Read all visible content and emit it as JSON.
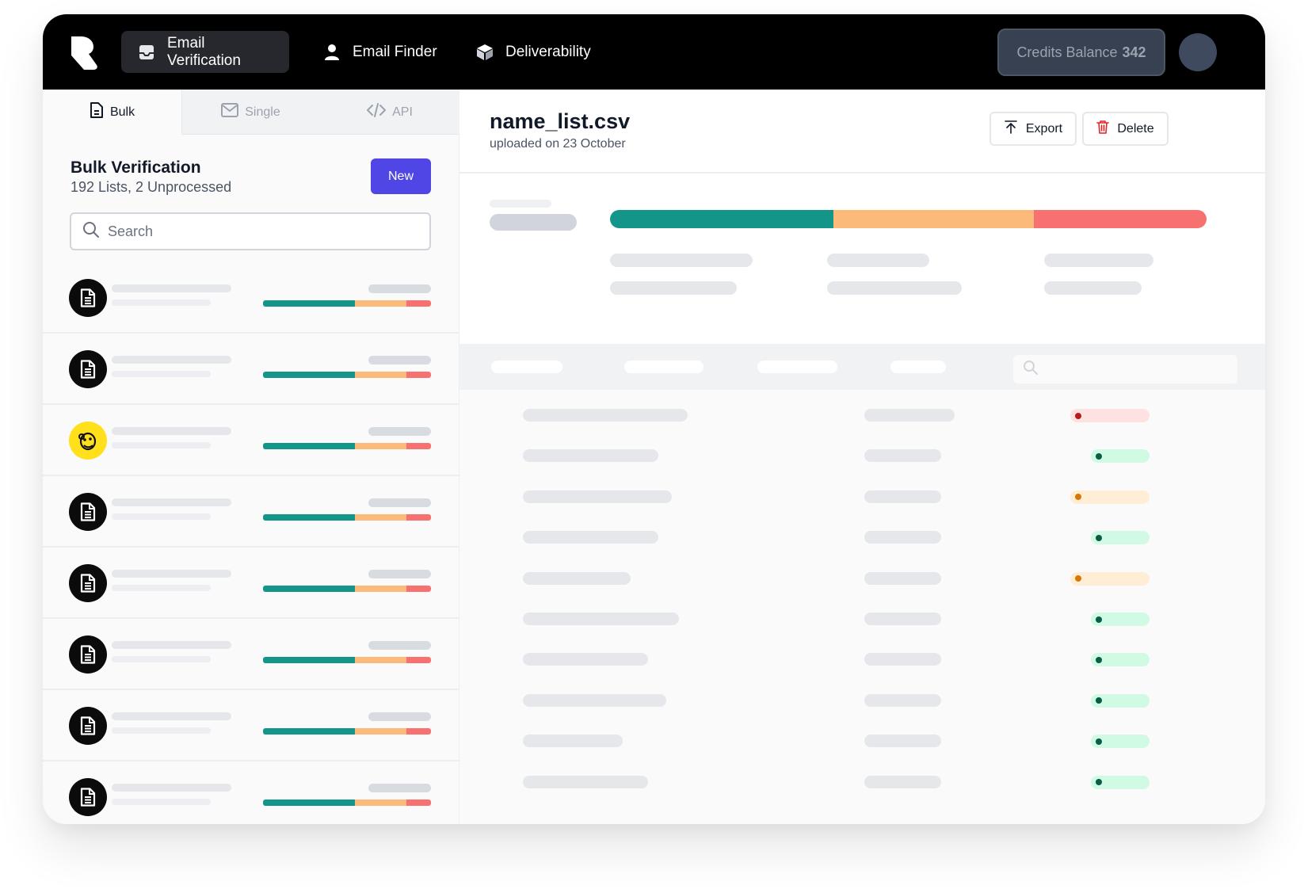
{
  "brand": {
    "logo": "brand-logo"
  },
  "nav": {
    "items": [
      {
        "label": "Email Verification",
        "icon": "inbox-icon",
        "active": true
      },
      {
        "label": "Email Finder",
        "icon": "user-icon",
        "active": false
      },
      {
        "label": "Deliverability",
        "icon": "box-icon",
        "active": false
      }
    ],
    "credits_label": "Credits Balance",
    "credits_value": "342"
  },
  "left": {
    "tabs": [
      {
        "label": "Bulk",
        "icon": "document-icon",
        "active": true
      },
      {
        "label": "Single",
        "icon": "envelope-icon",
        "active": false
      },
      {
        "label": "API",
        "icon": "code-icon",
        "active": false
      }
    ],
    "title": "Bulk Verification",
    "subtitle": "192 Lists, 2 Unprocessed",
    "new_label": "New",
    "search_placeholder": "Search",
    "list_items": [
      {
        "icon": "document-icon",
        "split": [
          0.545,
          0.31,
          0.145
        ]
      },
      {
        "icon": "document-icon",
        "split": [
          0.545,
          0.31,
          0.145
        ]
      },
      {
        "icon": "mailchimp-icon",
        "split": [
          0.545,
          0.31,
          0.145
        ]
      },
      {
        "icon": "document-icon",
        "split": [
          0.545,
          0.31,
          0.145
        ]
      },
      {
        "icon": "document-icon",
        "split": [
          0.545,
          0.31,
          0.145
        ]
      },
      {
        "icon": "document-icon",
        "split": [
          0.545,
          0.31,
          0.145
        ]
      },
      {
        "icon": "document-icon",
        "split": [
          0.545,
          0.31,
          0.145
        ]
      },
      {
        "icon": "document-icon",
        "split": [
          0.545,
          0.31,
          0.145
        ]
      }
    ]
  },
  "right": {
    "filename": "name_list.csv",
    "uploaded": "uploaded on 23 October",
    "export_label": "Export",
    "delete_label": "Delete",
    "overall_split": [
      0.375,
      0.335,
      0.29
    ],
    "rows_status": [
      "invalid",
      "valid",
      "risky",
      "valid",
      "risky",
      "valid",
      "valid",
      "valid",
      "valid",
      "valid"
    ],
    "status_colors": {
      "valid": {
        "bg": "#d1fae5",
        "dot": "#065f46"
      },
      "risky": {
        "bg": "#ffedd5",
        "dot": "#d97706"
      },
      "invalid": {
        "bg": "#fee2e2",
        "dot": "#b91c1c"
      }
    }
  }
}
